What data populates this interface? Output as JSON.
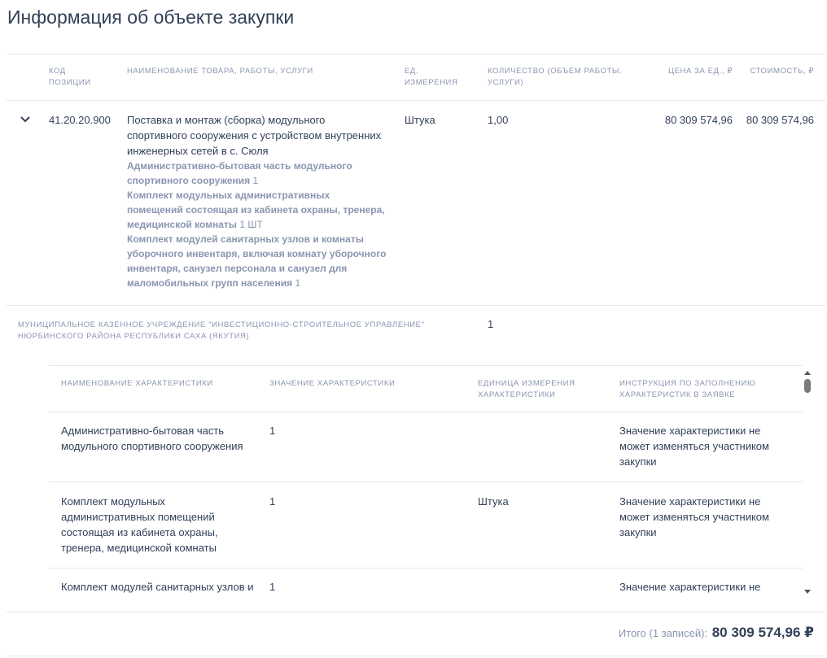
{
  "page_title": "Информация об объекте закупки",
  "table": {
    "headers": {
      "code": "КОД ПОЗИЦИИ",
      "name": "НАИМЕНОВАНИЕ ТОВАРА, РАБОТЫ, УСЛУГИ",
      "unit": "ЕД. ИЗМЕРЕНИЯ",
      "quantity": "КОЛИЧЕСТВО (ОБЪЕМ РАБОТЫ, УСЛУГИ)",
      "price": "ЦЕНА ЗА ЕД., ₽",
      "cost": "СТОИМОСТЬ, ₽"
    },
    "row": {
      "code": "41.20.20.900",
      "name": "Поставка и монтаж (сборка) модульного спортивного сооружения с устройством внутренних инженерных сетей в с. Сюля",
      "subitems": [
        {
          "label": "Административно-бытовая часть модульного спортивного сооружения",
          "qty": "1"
        },
        {
          "label": "Комплект модульных административных помещений состоящая из кабинета охраны, тренера, медицинской комнаты",
          "qty": "1 ШТ"
        },
        {
          "label": "Комплект модулей санитарных узлов и комнаты уборочного инвентаря, включая комнату уборочного инвентаря, санузел персонала и санузел для маломобильных групп населения",
          "qty": "1"
        }
      ],
      "unit": "Штука",
      "quantity": "1,00",
      "price": "80 309 574,96",
      "cost": "80 309 574,96"
    },
    "customer": {
      "name": "МУНИЦИПАЛЬНОЕ КАЗЕННОЕ УЧРЕЖДЕНИЕ \"ИНВЕСТИЦИОННО-СТРОИТЕЛЬНОЕ УПРАВЛЕНИЕ\" НЮРБИНСКОГО РАЙОНА РЕСПУБЛИКИ САХА (ЯКУТИЯ)",
      "quantity": "1"
    }
  },
  "characteristics": {
    "headers": {
      "name": "НАИМЕНОВАНИЕ ХАРАКТЕРИСТИКИ",
      "value": "ЗНАЧЕНИЕ ХАРАКТЕРИСТИКИ",
      "unit": "ЕДИНИЦА ИЗМЕРЕНИЯ ХАРАКТЕРИСТИКИ",
      "instruction": "ИНСТРУКЦИЯ ПО ЗАПОЛНЕНИЮ ХАРАКТЕРИСТИК В ЗАЯВКЕ"
    },
    "rows": [
      {
        "name": "Административно-бытовая часть модульного спортивного сооружения",
        "value": "1",
        "unit": "",
        "instruction": "Значение характеристики не может изменяться участником закупки"
      },
      {
        "name": "Комплект модульных административных помещений состоящая из кабинета охраны, тренера, медицинской комнаты",
        "value": "1",
        "unit": "Штука",
        "instruction": "Значение характеристики не может изменяться участником закупки"
      },
      {
        "name": "Комплект модулей санитарных узлов и комнаты уборочного инвентаря",
        "value": "1",
        "unit": "",
        "instruction": "Значение характеристики не может изменяться участником закупки"
      }
    ]
  },
  "total": {
    "label": "Итого (1 записей):",
    "amount": "80 309 574,96 ₽"
  },
  "icons": {
    "expand": "chevron-down-icon",
    "scroll_up": "arrow-up-icon",
    "scroll_down": "arrow-down-icon"
  }
}
